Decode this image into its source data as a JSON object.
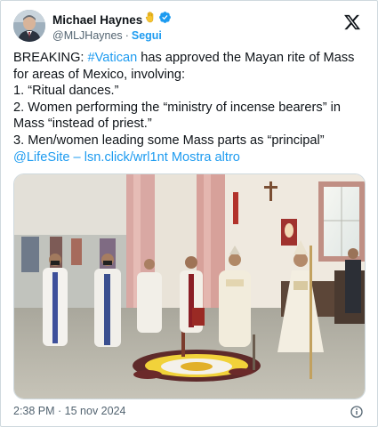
{
  "author": {
    "display_name": "Michael Haynes",
    "handle": "@MLJHaynes",
    "separator": "·",
    "follow_label": "Segui",
    "emoji_icon": "raised-hand-emoji-icon",
    "verified_icon": "verified-badge-icon",
    "verified_color": "#1d9bf0"
  },
  "post": {
    "line1_prefix": "BREAKING: ",
    "line1_hashtag": "#Vatican",
    "line1_suffix": " has approved the Mayan rite of Mass",
    "line2": "for areas of Mexico, involving:",
    "line3": "1. “Ritual dances.”",
    "line4": "2. Women performing the “ministry of incense bearers” in",
    "line5": "Mass “instead of priest.”",
    "line6": "3. Men/women leading some Mass parts as “principal”",
    "mention": "@LifeSite",
    "dash": " – ",
    "url": "lsn.click/wrl1nt",
    "show_more": "Mostra altro"
  },
  "footer": {
    "timestamp": "2:38 PM · 15 nov 2024",
    "info_icon": "info-icon"
  },
  "media": {
    "description_icon": "church-photo"
  },
  "colors": {
    "link": "#1d9bf0",
    "text": "#0f1419",
    "secondary": "#536471"
  }
}
